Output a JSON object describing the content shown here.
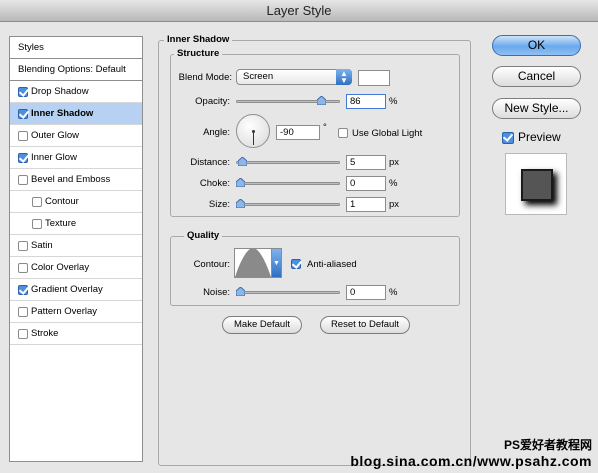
{
  "window": {
    "title": "Layer Style"
  },
  "styles_list": [
    {
      "label": "Styles",
      "checkbox": false,
      "checked": false,
      "selected": false,
      "bold": false,
      "indent": false,
      "header": true
    },
    {
      "label": "Blending Options: Default",
      "checkbox": false,
      "checked": false,
      "selected": false,
      "bold": false,
      "indent": false,
      "header": true
    },
    {
      "label": "Drop Shadow",
      "checkbox": true,
      "checked": true,
      "selected": false,
      "bold": false,
      "indent": false
    },
    {
      "label": "Inner Shadow",
      "checkbox": true,
      "checked": true,
      "selected": true,
      "bold": true,
      "indent": false
    },
    {
      "label": "Outer Glow",
      "checkbox": true,
      "checked": false,
      "selected": false,
      "bold": false,
      "indent": false
    },
    {
      "label": "Inner Glow",
      "checkbox": true,
      "checked": true,
      "selected": false,
      "bold": false,
      "indent": false
    },
    {
      "label": "Bevel and Emboss",
      "checkbox": true,
      "checked": false,
      "selected": false,
      "bold": false,
      "indent": false
    },
    {
      "label": "Contour",
      "checkbox": true,
      "checked": false,
      "selected": false,
      "bold": false,
      "indent": true
    },
    {
      "label": "Texture",
      "checkbox": true,
      "checked": false,
      "selected": false,
      "bold": false,
      "indent": true
    },
    {
      "label": "Satin",
      "checkbox": true,
      "checked": false,
      "selected": false,
      "bold": false,
      "indent": false
    },
    {
      "label": "Color Overlay",
      "checkbox": true,
      "checked": false,
      "selected": false,
      "bold": false,
      "indent": false
    },
    {
      "label": "Gradient Overlay",
      "checkbox": true,
      "checked": true,
      "selected": false,
      "bold": false,
      "indent": false
    },
    {
      "label": "Pattern Overlay",
      "checkbox": true,
      "checked": false,
      "selected": false,
      "bold": false,
      "indent": false
    },
    {
      "label": "Stroke",
      "checkbox": true,
      "checked": false,
      "selected": false,
      "bold": false,
      "indent": false
    }
  ],
  "panel": {
    "title": "Inner Shadow",
    "structure": {
      "title": "Structure",
      "blend_mode_label": "Blend Mode:",
      "blend_mode_value": "Screen",
      "swatch_color": "#ffffff",
      "opacity_label": "Opacity:",
      "opacity_value": "86",
      "opacity_unit": "%",
      "opacity_fraction": 0.86,
      "angle_label": "Angle:",
      "angle_value": "-90",
      "angle_unit": "°",
      "global_light_label": "Use Global Light",
      "global_light_checked": false,
      "distance_label": "Distance:",
      "distance_value": "5",
      "distance_unit": "px",
      "distance_fraction": 0.02,
      "choke_label": "Choke:",
      "choke_value": "0",
      "choke_unit": "%",
      "choke_fraction": 0,
      "size_label": "Size:",
      "size_value": "1",
      "size_unit": "px",
      "size_fraction": 0.0
    },
    "quality": {
      "title": "Quality",
      "contour_label": "Contour:",
      "anti_aliased_label": "Anti-aliased",
      "anti_aliased_checked": true,
      "noise_label": "Noise:",
      "noise_value": "0",
      "noise_unit": "%",
      "noise_fraction": 0
    },
    "make_default_label": "Make Default",
    "reset_default_label": "Reset to Default"
  },
  "actions": {
    "ok_label": "OK",
    "cancel_label": "Cancel",
    "new_style_label": "New Style...",
    "preview_label": "Preview",
    "preview_checked": true
  },
  "watermark": {
    "line1": "PS爱好者教程网",
    "line2": "blog.sina.com.cn/www.psahz.com"
  },
  "colors": {
    "accent": "#4e8fe0",
    "selected_row": "#b6d1f2"
  }
}
